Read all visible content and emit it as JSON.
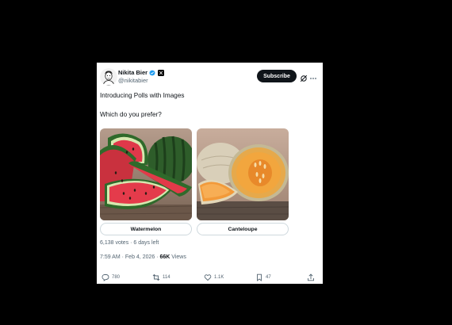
{
  "author": {
    "name": "Nikita Bier",
    "handle": "@nikitabier"
  },
  "header": {
    "subscribe_label": "Subscribe"
  },
  "tweet": {
    "line1": "Introducing Polls with Images",
    "line2": "Which do you prefer?"
  },
  "poll": {
    "options": [
      {
        "label": "Watermelon",
        "image": "watermelon-photo"
      },
      {
        "label": "Canteloupe",
        "image": "cantaloupe-photo"
      }
    ],
    "votes_text": "6,138 votes · 6 days left"
  },
  "meta": {
    "time_text": "7:59 AM · Feb 4, 2026 · ",
    "views_count": "66K",
    "views_label": " Views"
  },
  "actions": {
    "replies": "780",
    "reposts": "114",
    "likes": "1.1K",
    "bookmarks": "47"
  },
  "icons": [
    "verified-badge-icon",
    "affiliate-x-icon",
    "grok-icon",
    "more-icon",
    "reply-icon",
    "repost-icon",
    "like-icon",
    "bookmark-icon",
    "share-icon"
  ],
  "colors": {
    "background": "#000000",
    "card": "#ffffff",
    "text": "#0f1419",
    "secondary": "#536471",
    "verified": "#1d9bf0",
    "border": "#cfd9de"
  }
}
